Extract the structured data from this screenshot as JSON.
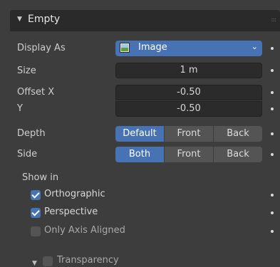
{
  "panel": {
    "title": "Empty",
    "collapse_icon": "triangle-down-icon",
    "grip_icon": "drag-grip-icon"
  },
  "display_as": {
    "label": "Display As",
    "value": "Image",
    "icon": "image-icon"
  },
  "size": {
    "label": "Size",
    "value": "1 m"
  },
  "offset": {
    "x_label": "Offset X",
    "x_value": "-0.50",
    "y_label": "Y",
    "y_value": "-0.50"
  },
  "depth": {
    "label": "Depth",
    "options": [
      "Default",
      "Front",
      "Back"
    ],
    "selected": "Default"
  },
  "side": {
    "label": "Side",
    "options": [
      "Both",
      "Front",
      "Back"
    ],
    "selected": "Both"
  },
  "show_in": {
    "label": "Show in",
    "orthographic": {
      "label": "Orthographic",
      "checked": true
    },
    "perspective": {
      "label": "Perspective",
      "checked": true
    },
    "only_axis_aligned": {
      "label": "Only Axis Aligned",
      "checked": false
    }
  },
  "transparency": {
    "label": "Transparency",
    "checked": false
  },
  "colors": {
    "accent": "#4772b3",
    "background": "#3d3d3d",
    "field": "#2b2b2b",
    "header": "#2a2a2a"
  }
}
